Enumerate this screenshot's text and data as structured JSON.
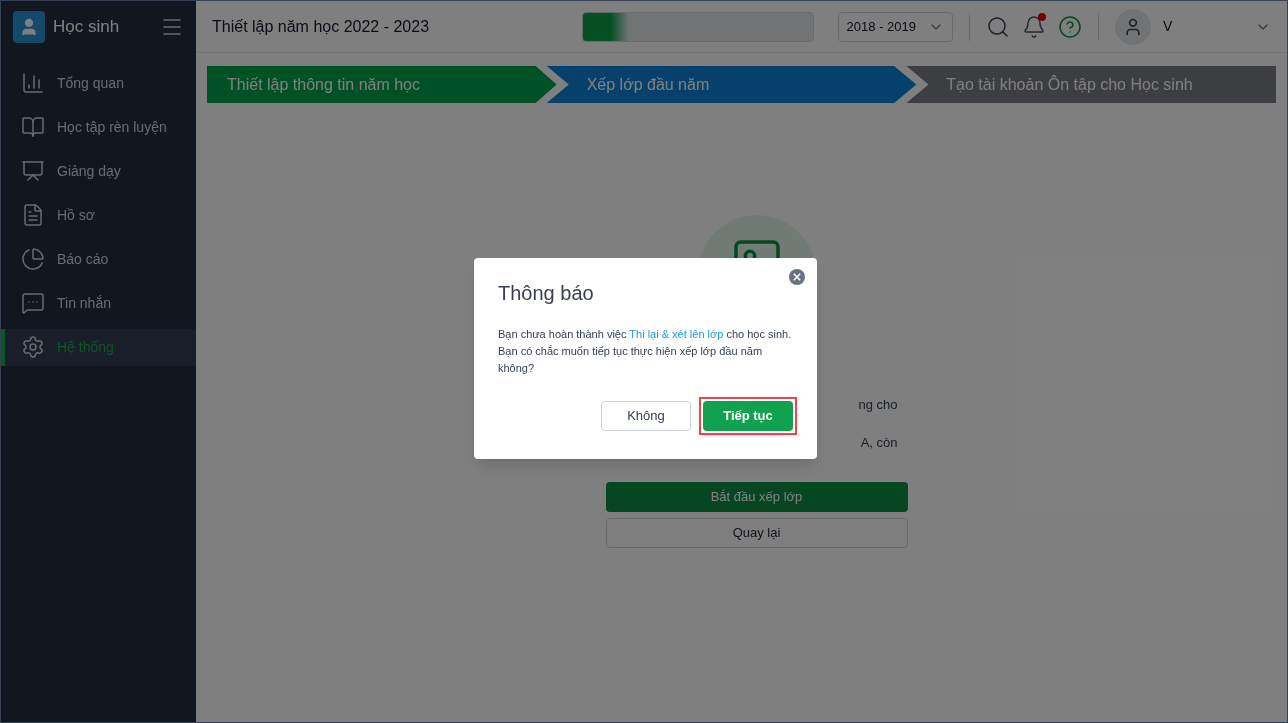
{
  "app": {
    "title": "Học sinh"
  },
  "sidebar": {
    "items": [
      {
        "label": "Tổng quan",
        "kind": "overview",
        "selected": false
      },
      {
        "label": "Học tập rèn luyện",
        "kind": "study",
        "selected": false
      },
      {
        "label": "Giảng dạy",
        "kind": "teaching",
        "selected": false
      },
      {
        "label": "Hồ sơ",
        "kind": "records",
        "selected": false
      },
      {
        "label": "Báo cáo",
        "kind": "reports",
        "selected": false
      },
      {
        "label": "Tin nhắn",
        "kind": "messages",
        "selected": false
      },
      {
        "label": "Hệ thống",
        "kind": "system",
        "selected": true
      }
    ]
  },
  "header": {
    "title": "Thiết lập năm học 2022 - 2023",
    "progress": {
      "level": 0.2
    },
    "year_select": "2018 - 2019",
    "user_name": "V",
    "notification_dot": true
  },
  "steps": [
    {
      "label": "Thiết lập thông tin năm học",
      "completed": true,
      "selected": false
    },
    {
      "label": "Xếp lớp đầu năm",
      "completed": false,
      "selected": true
    },
    {
      "label": "Tạo tài khoản Ôn tập cho Học sinh",
      "completed": false,
      "selected": false
    }
  ],
  "content": {
    "text_fragments": [
      "ng cho",
      "A, còn"
    ],
    "primary_button": "Bắt đầu xếp lớp",
    "secondary_button": "Quay lại"
  },
  "dialog": {
    "title": "Thông báo",
    "message": "Bạn chưa hoàn thành việc ",
    "link": "Thi lại & xét lên lớp",
    "message_end": " cho học sinh. Bạn có chắc muốn tiếp tục thực hiện xếp lớp đầu năm không?",
    "cancel_button": "Không",
    "confirm_button": "Tiếp tục",
    "confirm_highlighted": true
  }
}
